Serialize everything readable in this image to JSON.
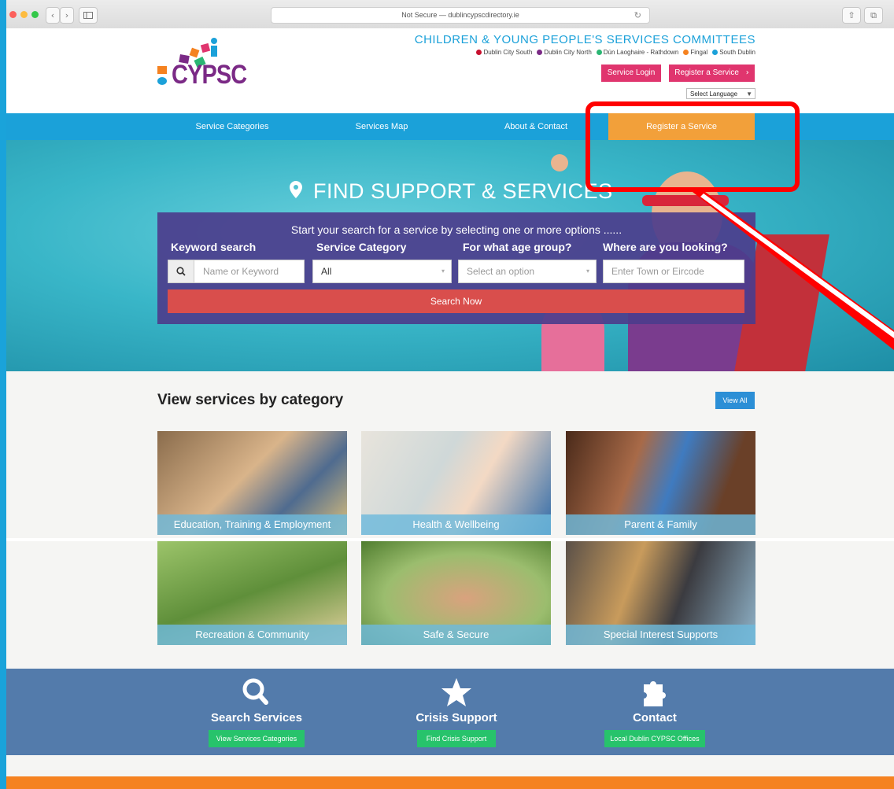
{
  "browser": {
    "url_text": "Not Secure — dublincypscdirectory.ie",
    "back": "‹",
    "forward": "›",
    "sidebar_icon": "sidebar-icon",
    "reload_glyph": "↻",
    "share_glyph": "⇧",
    "tabs_glyph": "⧉"
  },
  "header": {
    "logo_text": "CYPSC",
    "committee_title": "CHILDREN & YOUNG PEOPLE'S SERVICES COMMITTEES",
    "areas": [
      {
        "name": "Dublin City South",
        "color": "#c8102e"
      },
      {
        "name": "Dublin City North",
        "color": "#7b2a86"
      },
      {
        "name": "Dún Laoghaire - Rathdown",
        "color": "#2bb673"
      },
      {
        "name": "Fingal",
        "color": "#f58220"
      },
      {
        "name": "South Dublin",
        "color": "#1ba1d9"
      }
    ],
    "login_label": "Service Login",
    "register_label": "Register a Service",
    "register_arrow": "›",
    "language_label": "Select Language",
    "language_arrow": "▼"
  },
  "nav": {
    "items": [
      "Service Categories",
      "Services Map",
      "About & Contact",
      "Register a Service"
    ],
    "active_index": 3
  },
  "hero": {
    "pin_glyph": "⚲",
    "title": "FIND SUPPORT & SERVICES",
    "intro": "Start your search for a service by selecting one or more options ......",
    "labels": [
      "Keyword search",
      "Service Category",
      "For what age group?",
      "Where are you looking?"
    ],
    "keyword_placeholder": "Name or Keyword",
    "category_value": "All",
    "age_placeholder": "Select an option",
    "location_placeholder": "Enter Town or Eircode",
    "search_button": "Search Now",
    "caret_glyph": "▾",
    "search_glyph": "🔍"
  },
  "categories": {
    "heading": "View services by category",
    "view_all": "View All",
    "tiles": [
      "Education, Training & Employment",
      "Health & Wellbeing",
      "Parent & Family",
      "Recreation & Community",
      "Safe & Secure",
      "Special Interest Supports"
    ]
  },
  "features": [
    {
      "icon": "search-icon",
      "title": "Search Services",
      "button": "View Services Categories"
    },
    {
      "icon": "star-icon",
      "title": "Crisis Support",
      "button": "Find Crisis Support"
    },
    {
      "icon": "puzzle-icon",
      "title": "Contact",
      "button": "Local Dublin CYPSC Offices"
    }
  ],
  "colors": {
    "nav": "#1ba1d9",
    "active_nav": "#f2a03a",
    "pink": "#e0356e",
    "search_panel": "#4c3d8c",
    "search_button": "#d94e4c",
    "band": "#537bab",
    "green": "#27c36b",
    "footer": "#f58220",
    "annotation": "#ff0000"
  }
}
